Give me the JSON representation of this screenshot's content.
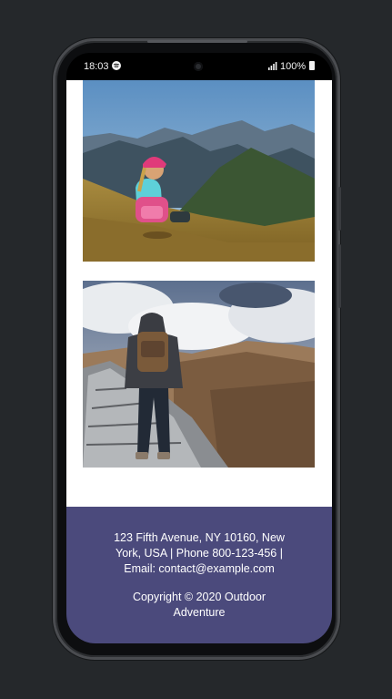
{
  "status_bar": {
    "time": "18:03",
    "battery": "100%",
    "icons": [
      "spotify-icon",
      "camera-icon",
      "signal-icon",
      "battery-icon"
    ]
  },
  "gallery": {
    "images": [
      {
        "name": "girl-on-mountain-photo"
      },
      {
        "name": "hiker-on-rocky-ridge-photo"
      }
    ]
  },
  "footer": {
    "address": "123 Fifth Avenue, NY 10160, New York, USA | Phone 800-123-456 | Email: contact@example.com",
    "copyright": "Copyright © 2020 Outdoor Adventure"
  },
  "colors": {
    "footer_bg": "#4b4a7c",
    "page_bg": "#ffffff",
    "backdrop": "#25282b"
  }
}
